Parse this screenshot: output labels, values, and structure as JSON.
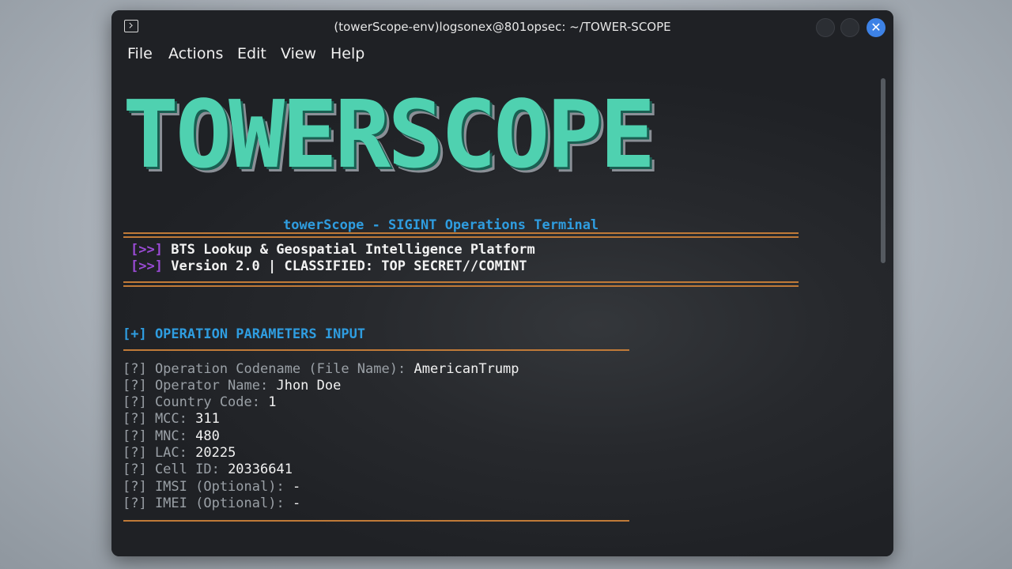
{
  "window": {
    "title": "(towerScope-env)logsonex@801opsec: ~/TOWER-SCOPE",
    "close_symbol": "✕"
  },
  "menu": [
    "File",
    "Actions",
    "Edit",
    "View",
    "Help"
  ],
  "banner": "TOWERSCOPE",
  "subtitle": "towerScope - SIGINT Operations Terminal",
  "info_prefix": "[>>]",
  "info_lines": [
    "BTS Lookup & Geospatial Intelligence Platform",
    "Version 2.0 | CLASSIFIED: TOP SECRET//COMINT"
  ],
  "section_title": "[+] OPERATION PARAMETERS INPUT",
  "params": [
    {
      "label": "[?] Operation Codename (File Name): ",
      "value": "AmericanTrump"
    },
    {
      "label": "[?] Operator Name: ",
      "value": "Jhon Doe"
    },
    {
      "label": "[?] Country Code: ",
      "value": "1"
    },
    {
      "label": "[?] MCC: ",
      "value": "311"
    },
    {
      "label": "[?] MNC: ",
      "value": "480"
    },
    {
      "label": "[?] LAC: ",
      "value": "20225"
    },
    {
      "label": "[?] Cell ID: ",
      "value": "20336641"
    },
    {
      "label": "[?] IMSI (Optional): ",
      "value": "-"
    },
    {
      "label": "[?] IMEI (Optional): ",
      "value": "-"
    }
  ],
  "colors": {
    "banner": "#4fd1b0",
    "accent_blue": "#2f9de0",
    "accent_purple": "#9b4bd6",
    "rule_orange": "#c07a38",
    "prompt_gray": "#9aa0a6"
  }
}
